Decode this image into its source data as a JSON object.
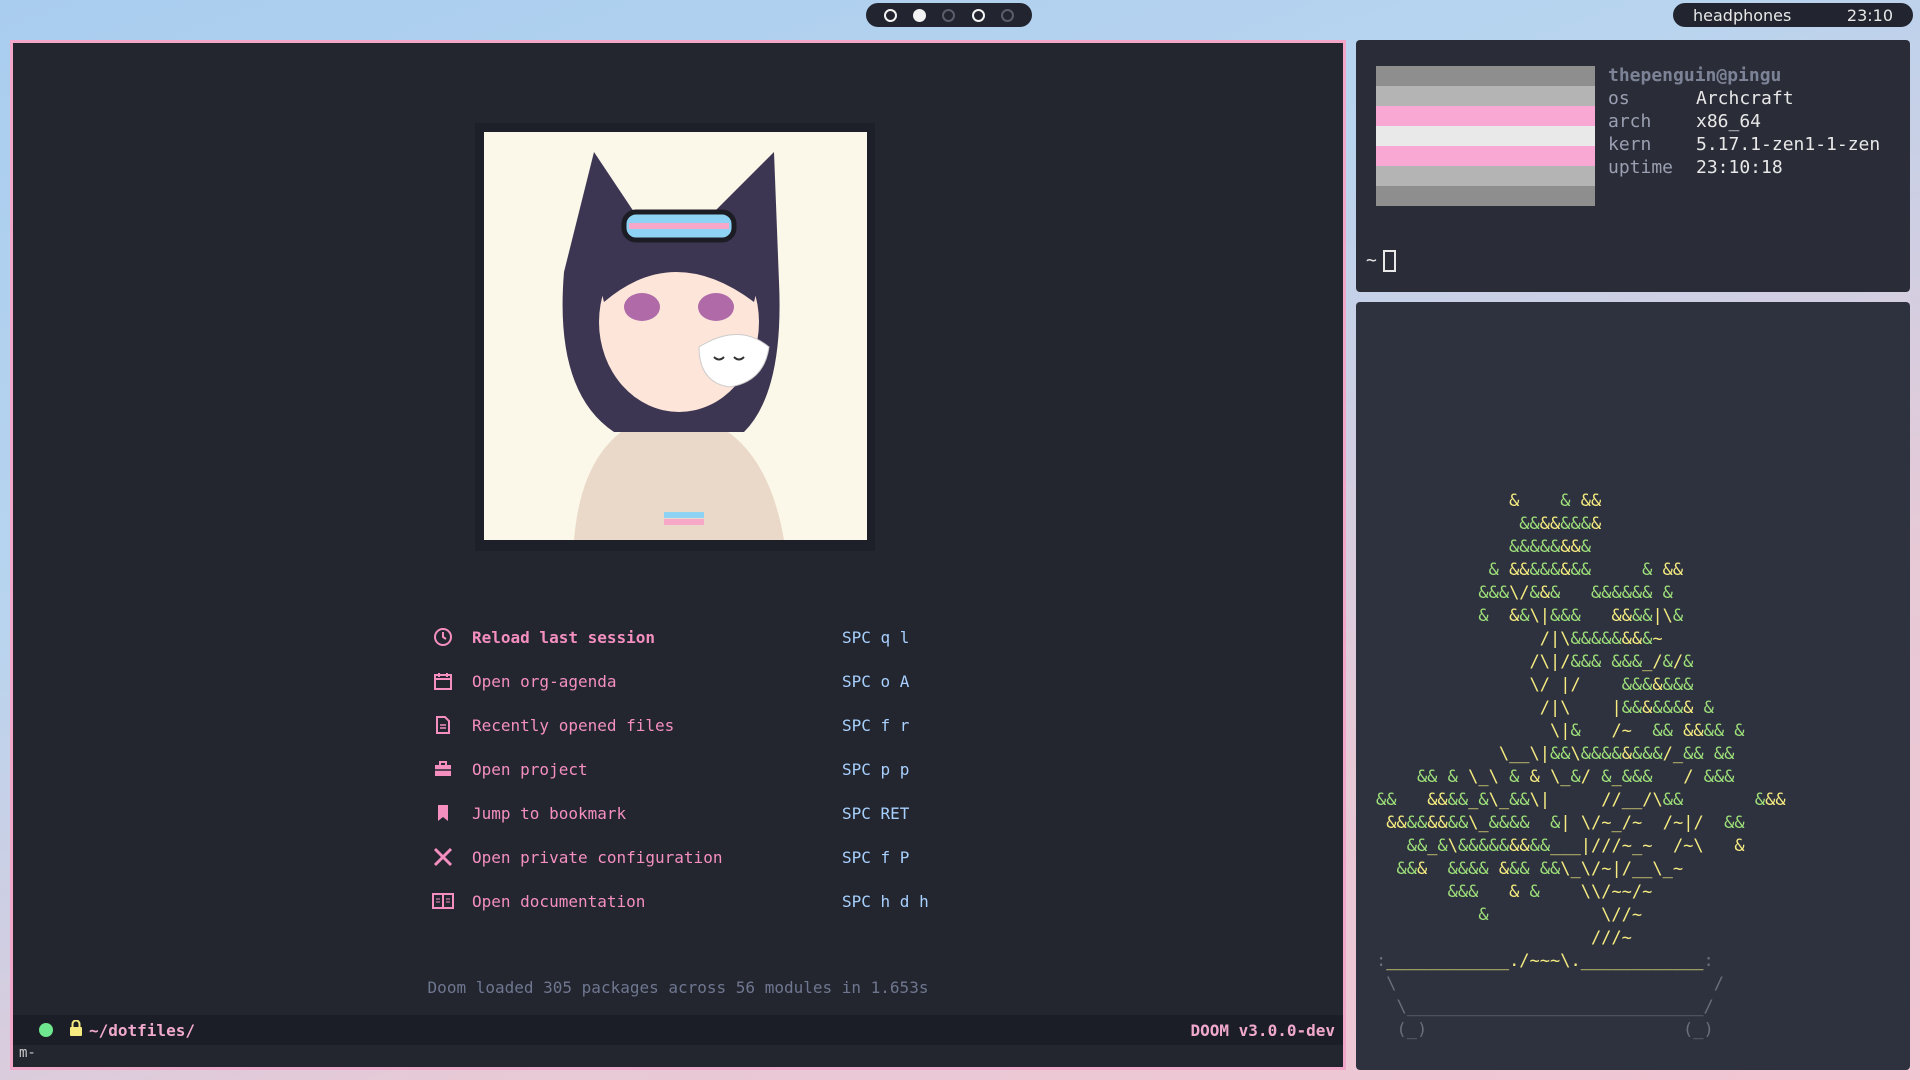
{
  "topbar": {
    "workspaces": [
      "ws1",
      "ws2",
      "ws3",
      "ws4",
      "ws5"
    ],
    "active_workspace": 2,
    "audio": "headphones",
    "time": "23:10"
  },
  "emacs": {
    "menu": [
      {
        "icon": "history-icon",
        "label": "Reload last session",
        "key": "SPC q l"
      },
      {
        "icon": "calendar-icon",
        "label": "Open org-agenda",
        "key": "SPC o A"
      },
      {
        "icon": "file-text-icon",
        "label": "Recently opened files",
        "key": "SPC f r"
      },
      {
        "icon": "briefcase-icon",
        "label": "Open project",
        "key": "SPC p p"
      },
      {
        "icon": "bookmark-icon",
        "label": "Jump to bookmark",
        "key": "SPC RET"
      },
      {
        "icon": "tools-icon",
        "label": "Open private configuration",
        "key": "SPC f P"
      },
      {
        "icon": "book-icon",
        "label": "Open documentation",
        "key": "SPC h d h"
      }
    ],
    "loaded": "Doom loaded 305 packages across 56 modules in 1.653s",
    "modeline": {
      "path": "~/dotfiles/",
      "version": "DOOM v3.0.0-dev"
    },
    "minibuffer": "m-"
  },
  "fetch": {
    "user": "thepenguin@pingu",
    "rows": [
      [
        "os",
        "Archcraft"
      ],
      [
        "arch",
        "x86_64"
      ],
      [
        "kern",
        "5.17.1-zen1-1-zen"
      ],
      [
        "uptime",
        "23:10:18"
      ]
    ],
    "prompt": "~",
    "flag_colors": [
      "#8e8e8e",
      "#b4b4b4",
      "#f9a8d4",
      "#e9e9e9",
      "#f9a8d4",
      "#b4b4b4",
      "#8e8e8e"
    ]
  },
  "colors": {
    "accent": "#f48fc0",
    "keys": "#a8d0ff",
    "tree": "#9ee07a"
  }
}
